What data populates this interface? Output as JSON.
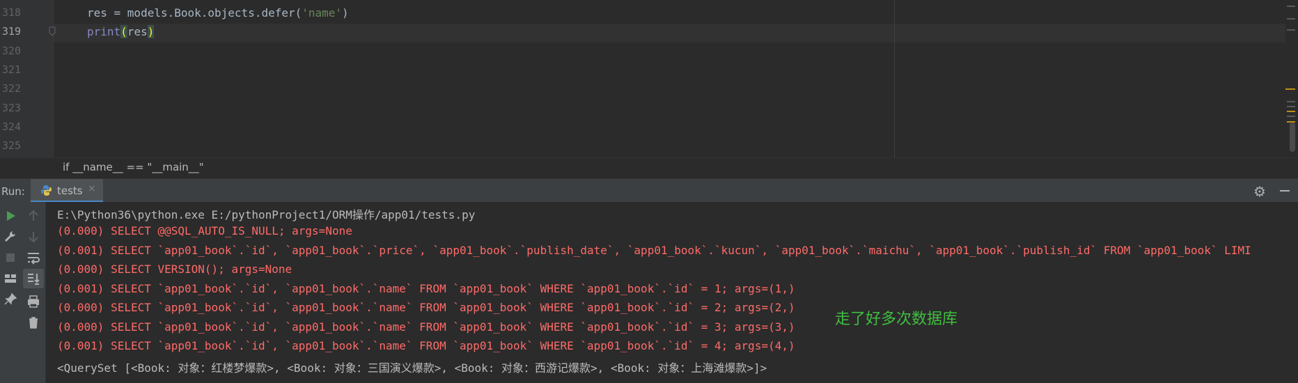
{
  "editor": {
    "line_numbers": [
      "318",
      "319",
      "320",
      "321",
      "322",
      "323",
      "324",
      "325"
    ],
    "code_line_318": {
      "pre": "res = models.Book.objects.defer(",
      "str": "'name'",
      "post": ")"
    },
    "code_line_319": {
      "builtin": "print",
      "open_paren": "(",
      "arg": "res",
      "close_paren": ")"
    },
    "breadcrumb": "if __name__ == \"__main__\""
  },
  "run_panel": {
    "label": "Run:",
    "tab_label": "tests",
    "tab_close": "×",
    "settings_icon": "gear-icon",
    "minimize_icon": "minimize-icon",
    "toolbar_icons": [
      "rerun-icon",
      "up-arrow-icon",
      "wrench-icon",
      "down-arrow-icon",
      "stop-icon",
      "soft-wrap-icon",
      "layout-icon",
      "scroll-to-end-icon",
      "pin-icon",
      "print-icon",
      "trash-icon"
    ]
  },
  "console": {
    "lines": [
      {
        "text": "E:\\Python36\\python.exe E:/pythonProject1/ORM操作/app01/tests.py",
        "kind": "normal"
      },
      {
        "text": "(0.000) SELECT @@SQL_AUTO_IS_NULL; args=None",
        "kind": "err"
      },
      {
        "text": "(0.001) SELECT `app01_book`.`id`, `app01_book`.`price`, `app01_book`.`publish_date`, `app01_book`.`kucun`, `app01_book`.`maichu`, `app01_book`.`publish_id` FROM `app01_book` LIMI",
        "kind": "err"
      },
      {
        "text": "(0.000) SELECT VERSION(); args=None",
        "kind": "err"
      },
      {
        "text": "(0.001) SELECT `app01_book`.`id`, `app01_book`.`name` FROM `app01_book` WHERE `app01_book`.`id` = 1; args=(1,)",
        "kind": "err"
      },
      {
        "text": "(0.000) SELECT `app01_book`.`id`, `app01_book`.`name` FROM `app01_book` WHERE `app01_book`.`id` = 2; args=(2,)",
        "kind": "err"
      },
      {
        "text": "(0.000) SELECT `app01_book`.`id`, `app01_book`.`name` FROM `app01_book` WHERE `app01_book`.`id` = 3; args=(3,)",
        "kind": "err"
      },
      {
        "text": "(0.001) SELECT `app01_book`.`id`, `app01_book`.`name` FROM `app01_book` WHERE `app01_book`.`id` = 4; args=(4,)",
        "kind": "err"
      },
      {
        "text": "<QuerySet [<Book: 对象：红楼梦爆款>, <Book: 对象：三国演义爆款>, <Book: 对象：西游记爆款>, <Book: 对象：上海滩爆款>]>",
        "kind": "normal"
      }
    ],
    "annotation": "走了好多次数据库"
  },
  "colors": {
    "background": "#2b2b2b",
    "error_text": "#ff6b68",
    "normal_text": "#bbbbbb",
    "annotation": "#3fbf3f",
    "string": "#6a8759",
    "builtin": "#8888c6",
    "warning_mark": "#be9117"
  }
}
